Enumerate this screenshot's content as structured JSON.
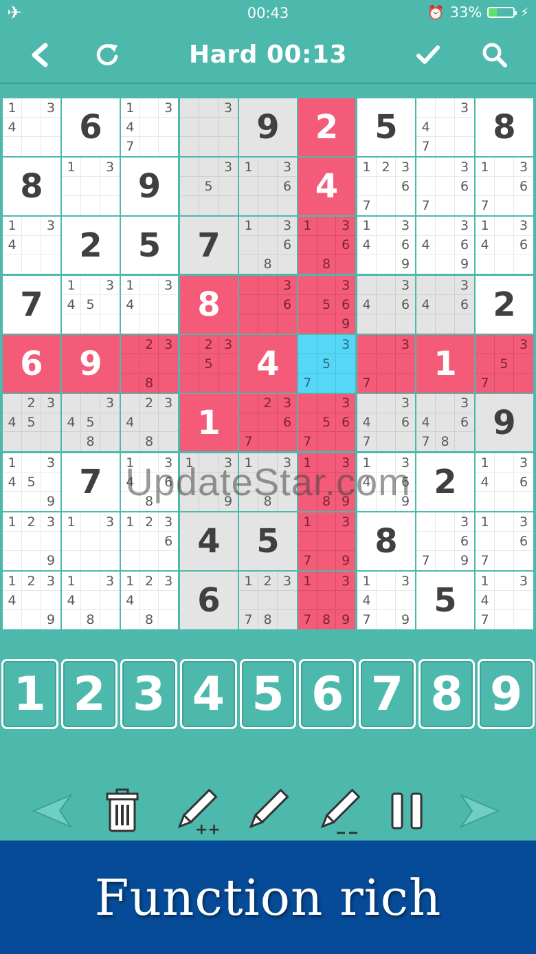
{
  "status_bar": {
    "time": "00:43",
    "battery_text": "33%",
    "battery_level": 0.33,
    "battery_color": "#5be36b"
  },
  "header": {
    "title": "Hard 00:13",
    "left_icons": [
      "back-icon",
      "restart-icon"
    ],
    "right_icons": [
      "check-icon",
      "search-icon"
    ]
  },
  "board": {
    "colors": {
      "white": "#ffffff",
      "gray": "#e4e4e4",
      "red": "#f45b78",
      "blue": "#55d8f7"
    },
    "rows": [
      [
        {
          "notes": "1,3,4"
        },
        {
          "value": "6"
        },
        {
          "notes": "1,3,4,7"
        },
        {
          "notes": "3"
        },
        {
          "value": "9"
        },
        {
          "value": "2"
        },
        {
          "value": "5"
        },
        {
          "notes": "3,4,7"
        },
        {
          "value": "8"
        }
      ],
      [
        {
          "value": "8"
        },
        {
          "notes": "1,3"
        },
        {
          "value": "9"
        },
        {
          "notes": "3,5"
        },
        {
          "notes": "1,3,6"
        },
        {
          "value": "4"
        },
        {
          "notes": "1,2,3,6,7"
        },
        {
          "notes": "3,6,7"
        },
        {
          "notes": "1,3,6,7"
        }
      ],
      [
        {
          "notes": "1,3,4"
        },
        {
          "value": "2"
        },
        {
          "value": "5"
        },
        {
          "value": "7"
        },
        {
          "notes": "1,3,6,8"
        },
        {
          "notes": "1,3,6,8"
        },
        {
          "notes": "1,3,4,6,9"
        },
        {
          "notes": "3,4,6,9"
        },
        {
          "notes": "1,3,4,6"
        }
      ],
      [
        {
          "value": "7"
        },
        {
          "notes": "1,3,4,5"
        },
        {
          "notes": "1,3,4"
        },
        {
          "value": "8"
        },
        {
          "notes": "3,6"
        },
        {
          "notes": "3,5,6,9"
        },
        {
          "notes": "3,4,6"
        },
        {
          "notes": "3,4,6"
        },
        {
          "value": "2"
        }
      ],
      [
        {
          "value": "6"
        },
        {
          "value": "9"
        },
        {
          "notes": "2,3,8"
        },
        {
          "notes": "2,3,5"
        },
        {
          "value": "4"
        },
        {
          "notes": "3,5,7"
        },
        {
          "notes": "3,7"
        },
        {
          "value": "1"
        },
        {
          "notes": "3,5,7"
        }
      ],
      [
        {
          "notes": "2,3,4,5"
        },
        {
          "notes": "3,4,5,8"
        },
        {
          "notes": "2,3,4,8"
        },
        {
          "value": "1"
        },
        {
          "notes": "2,3,6,7"
        },
        {
          "notes": "3,5,6,7"
        },
        {
          "notes": "3,4,6,7"
        },
        {
          "notes": "3,4,6,7,8"
        },
        {
          "value": "9"
        }
      ],
      [
        {
          "notes": "1,3,4,5,9"
        },
        {
          "value": "7"
        },
        {
          "notes": "1,3,4,6,8"
        },
        {
          "notes": "1,3,9"
        },
        {
          "notes": "1,3,8"
        },
        {
          "notes": "1,3,8,9"
        },
        {
          "notes": "1,3,4,6,9"
        },
        {
          "value": "2"
        },
        {
          "notes": "1,3,4,6"
        }
      ],
      [
        {
          "notes": "1,2,3,9"
        },
        {
          "notes": "1,3"
        },
        {
          "notes": "1,2,3,6"
        },
        {
          "value": "4"
        },
        {
          "value": "5"
        },
        {
          "notes": "1,3,7,9"
        },
        {
          "value": "8"
        },
        {
          "notes": "3,6,7,9"
        },
        {
          "notes": "1,3,6,7"
        }
      ],
      [
        {
          "notes": "1,2,3,4,9"
        },
        {
          "notes": "1,3,4,8"
        },
        {
          "notes": "1,2,3,4,8"
        },
        {
          "value": "6"
        },
        {
          "notes": "1,2,3,7,8"
        },
        {
          "notes": "1,3,7,8,9"
        },
        {
          "notes": "1,3,4,7,9"
        },
        {
          "value": "5"
        },
        {
          "notes": "1,3,4,7"
        }
      ]
    ],
    "highlight": [
      "wwwggrwww",
      "wwwggrwww",
      "wwwggrwww",
      "wwwrrrggw",
      "rrrrrbrrr",
      "gggrrrggg",
      "wwwggrwww",
      "wwwggrwww",
      "wwwggrwww"
    ]
  },
  "watermark": "UpdateStar.com",
  "numpad": [
    "1",
    "2",
    "3",
    "4",
    "5",
    "6",
    "7",
    "8",
    "9"
  ],
  "toolbar": {
    "items": [
      {
        "name": "undo-button",
        "icon": "undo-arrow-icon"
      },
      {
        "name": "erase-button",
        "icon": "trash-icon"
      },
      {
        "name": "note-add-all-button",
        "icon": "pencil-plus-icon"
      },
      {
        "name": "note-mode-button",
        "icon": "pencil-icon"
      },
      {
        "name": "note-clear-button",
        "icon": "pencil-minus-icon"
      },
      {
        "name": "pause-button",
        "icon": "pause-icon"
      },
      {
        "name": "redo-button",
        "icon": "redo-arrow-icon"
      }
    ]
  },
  "banner": {
    "text": "Function rich",
    "color": "#064b97"
  }
}
